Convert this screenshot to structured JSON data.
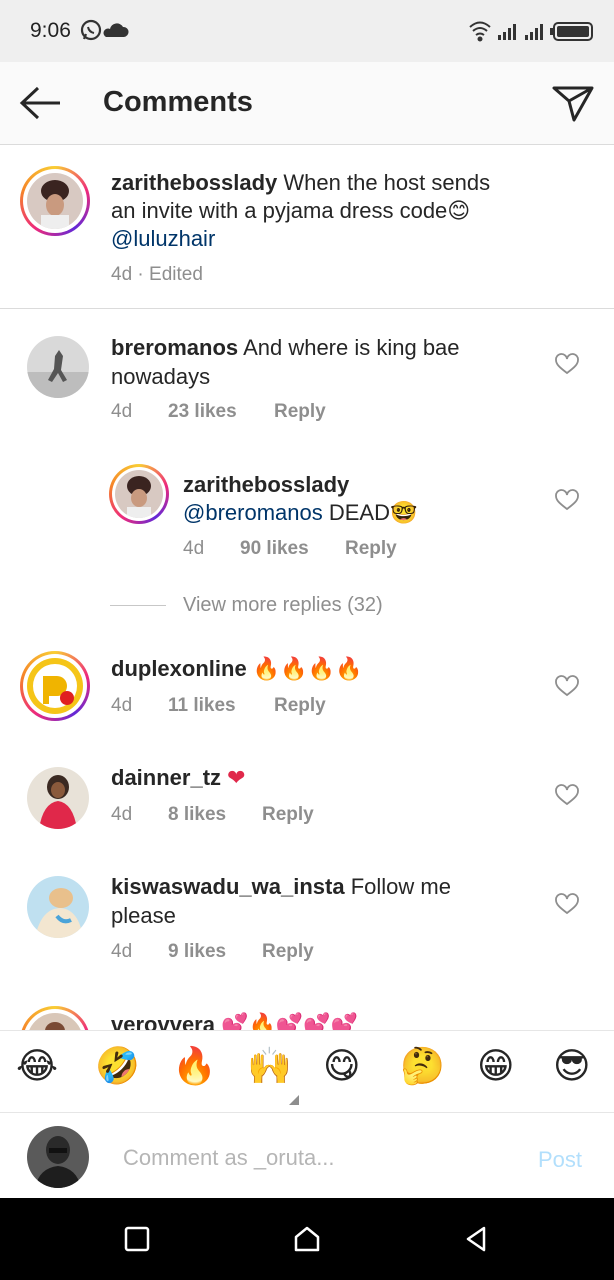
{
  "status_bar": {
    "time": "9:06"
  },
  "header": {
    "title": "Comments"
  },
  "caption": {
    "username": "zarithebosslady",
    "line1": "When the host sends",
    "line2": "an invite with a pyjama dress code😊",
    "mention": "@luluzhair",
    "meta": "4d · Edited"
  },
  "comments": [
    {
      "username": "breromanos",
      "text_line1": "And where is king bae",
      "text_line2": "nowadays",
      "time": "4d",
      "likes": "23 likes",
      "reply": "Reply"
    },
    {
      "username": "zarithebosslady",
      "mention": "@breromanos",
      "text": "DEAD🤓",
      "time": "4d",
      "likes": "90 likes",
      "reply": "Reply"
    },
    {
      "username": "duplexonline",
      "text": "🔥🔥🔥🔥",
      "time": "4d",
      "likes": "11 likes",
      "reply": "Reply"
    },
    {
      "username": "dainner_tz",
      "text": "❤",
      "time": "4d",
      "likes": "8 likes",
      "reply": "Reply"
    },
    {
      "username": "kiswaswadu_wa_insta",
      "text_line1": "Follow me",
      "text_line2": "please",
      "time": "4d",
      "likes": "9 likes",
      "reply": "Reply"
    },
    {
      "username": "verovvera",
      "text": "💕🔥💕💕💕"
    }
  ],
  "view_more_replies": "View more replies (32)",
  "emoji_bar": [
    "😂",
    "🤣",
    "🔥",
    "🙌",
    "😋",
    "🤔",
    "😁",
    "😎"
  ],
  "composer": {
    "placeholder": "Comment as _oruta...",
    "post_label": "Post"
  },
  "colors": {
    "mention": "#003569",
    "meta": "#8e8e8e",
    "post_disabled": "#b2dffc",
    "heart": "#8e8e8e"
  }
}
